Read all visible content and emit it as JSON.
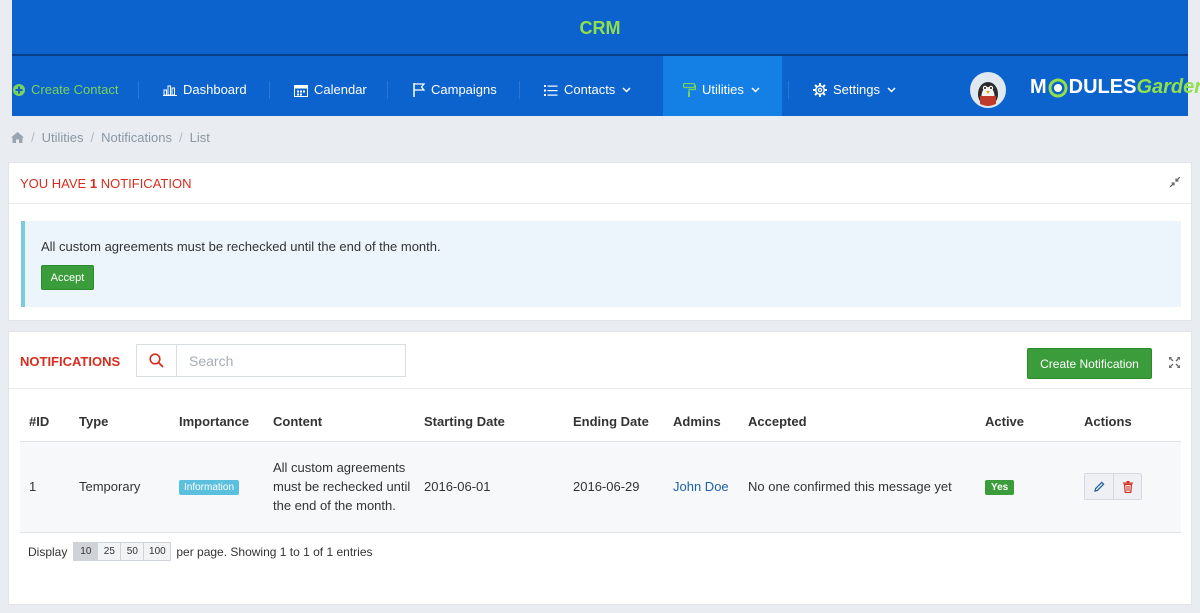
{
  "app": {
    "title": "CRM"
  },
  "nav": {
    "create_contact": "Create Contact",
    "dashboard": "Dashboard",
    "calendar": "Calendar",
    "campaigns": "Campaigns",
    "contacts": "Contacts",
    "utilities": "Utilities",
    "settings": "Settings",
    "active": "Utilities"
  },
  "logo": {
    "part1": "M",
    "part2": "DULES",
    "part3": "Garden"
  },
  "breadcrumb": {
    "items": [
      "Utilities",
      "Notifications",
      "List"
    ]
  },
  "notice_panel": {
    "title_prefix": "YOU HAVE",
    "count": "1",
    "title_suffix": "NOTIFICATION",
    "message": "All custom agreements must be rechecked until the end of the month.",
    "accept_label": "Accept"
  },
  "list_panel": {
    "title": "NOTIFICATIONS",
    "search_placeholder": "Search",
    "create_label": "Create Notification"
  },
  "table": {
    "headers": [
      "#ID",
      "Type",
      "Importance",
      "Content",
      "Starting Date",
      "Ending Date",
      "Admins",
      "Accepted",
      "Active",
      "Actions"
    ],
    "rows": [
      {
        "id": "1",
        "type": "Temporary",
        "importance": "Information",
        "content": "All custom agreements must be rechecked until the end of the month.",
        "start": "2016-06-01",
        "end": "2016-06-29",
        "admins": "John Doe",
        "accepted": "No one confirmed this message yet",
        "active": "Yes"
      }
    ]
  },
  "pagination": {
    "display_label": "Display",
    "sizes": [
      "10",
      "25",
      "50",
      "100"
    ],
    "selected": "10",
    "summary": "per page. Showing 1 to 1 of 1 entries"
  },
  "colors": {
    "header_bg": "#0c63cd",
    "active_tab": "#1480e6",
    "accent_green": "#8fe04a",
    "danger_red": "#d62d1f",
    "success": "#3a9c3a",
    "info": "#5bc0de"
  }
}
